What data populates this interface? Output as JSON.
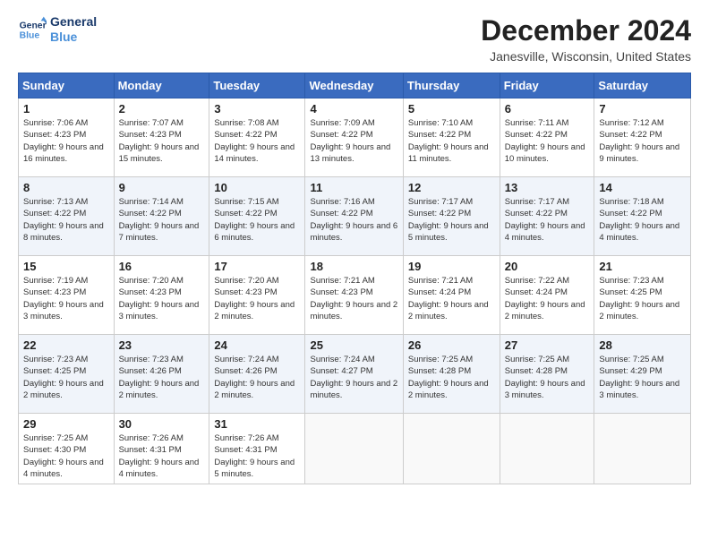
{
  "header": {
    "logo_line1": "General",
    "logo_line2": "Blue",
    "month_title": "December 2024",
    "location": "Janesville, Wisconsin, United States"
  },
  "weekdays": [
    "Sunday",
    "Monday",
    "Tuesday",
    "Wednesday",
    "Thursday",
    "Friday",
    "Saturday"
  ],
  "weeks": [
    [
      {
        "day": "1",
        "sunrise": "7:06 AM",
        "sunset": "4:23 PM",
        "daylight": "9 hours and 16 minutes."
      },
      {
        "day": "2",
        "sunrise": "7:07 AM",
        "sunset": "4:23 PM",
        "daylight": "9 hours and 15 minutes."
      },
      {
        "day": "3",
        "sunrise": "7:08 AM",
        "sunset": "4:22 PM",
        "daylight": "9 hours and 14 minutes."
      },
      {
        "day": "4",
        "sunrise": "7:09 AM",
        "sunset": "4:22 PM",
        "daylight": "9 hours and 13 minutes."
      },
      {
        "day": "5",
        "sunrise": "7:10 AM",
        "sunset": "4:22 PM",
        "daylight": "9 hours and 11 minutes."
      },
      {
        "day": "6",
        "sunrise": "7:11 AM",
        "sunset": "4:22 PM",
        "daylight": "9 hours and 10 minutes."
      },
      {
        "day": "7",
        "sunrise": "7:12 AM",
        "sunset": "4:22 PM",
        "daylight": "9 hours and 9 minutes."
      }
    ],
    [
      {
        "day": "8",
        "sunrise": "7:13 AM",
        "sunset": "4:22 PM",
        "daylight": "9 hours and 8 minutes."
      },
      {
        "day": "9",
        "sunrise": "7:14 AM",
        "sunset": "4:22 PM",
        "daylight": "9 hours and 7 minutes."
      },
      {
        "day": "10",
        "sunrise": "7:15 AM",
        "sunset": "4:22 PM",
        "daylight": "9 hours and 6 minutes."
      },
      {
        "day": "11",
        "sunrise": "7:16 AM",
        "sunset": "4:22 PM",
        "daylight": "9 hours and 6 minutes."
      },
      {
        "day": "12",
        "sunrise": "7:17 AM",
        "sunset": "4:22 PM",
        "daylight": "9 hours and 5 minutes."
      },
      {
        "day": "13",
        "sunrise": "7:17 AM",
        "sunset": "4:22 PM",
        "daylight": "9 hours and 4 minutes."
      },
      {
        "day": "14",
        "sunrise": "7:18 AM",
        "sunset": "4:22 PM",
        "daylight": "9 hours and 4 minutes."
      }
    ],
    [
      {
        "day": "15",
        "sunrise": "7:19 AM",
        "sunset": "4:23 PM",
        "daylight": "9 hours and 3 minutes."
      },
      {
        "day": "16",
        "sunrise": "7:20 AM",
        "sunset": "4:23 PM",
        "daylight": "9 hours and 3 minutes."
      },
      {
        "day": "17",
        "sunrise": "7:20 AM",
        "sunset": "4:23 PM",
        "daylight": "9 hours and 2 minutes."
      },
      {
        "day": "18",
        "sunrise": "7:21 AM",
        "sunset": "4:23 PM",
        "daylight": "9 hours and 2 minutes."
      },
      {
        "day": "19",
        "sunrise": "7:21 AM",
        "sunset": "4:24 PM",
        "daylight": "9 hours and 2 minutes."
      },
      {
        "day": "20",
        "sunrise": "7:22 AM",
        "sunset": "4:24 PM",
        "daylight": "9 hours and 2 minutes."
      },
      {
        "day": "21",
        "sunrise": "7:23 AM",
        "sunset": "4:25 PM",
        "daylight": "9 hours and 2 minutes."
      }
    ],
    [
      {
        "day": "22",
        "sunrise": "7:23 AM",
        "sunset": "4:25 PM",
        "daylight": "9 hours and 2 minutes."
      },
      {
        "day": "23",
        "sunrise": "7:23 AM",
        "sunset": "4:26 PM",
        "daylight": "9 hours and 2 minutes."
      },
      {
        "day": "24",
        "sunrise": "7:24 AM",
        "sunset": "4:26 PM",
        "daylight": "9 hours and 2 minutes."
      },
      {
        "day": "25",
        "sunrise": "7:24 AM",
        "sunset": "4:27 PM",
        "daylight": "9 hours and 2 minutes."
      },
      {
        "day": "26",
        "sunrise": "7:25 AM",
        "sunset": "4:28 PM",
        "daylight": "9 hours and 2 minutes."
      },
      {
        "day": "27",
        "sunrise": "7:25 AM",
        "sunset": "4:28 PM",
        "daylight": "9 hours and 3 minutes."
      },
      {
        "day": "28",
        "sunrise": "7:25 AM",
        "sunset": "4:29 PM",
        "daylight": "9 hours and 3 minutes."
      }
    ],
    [
      {
        "day": "29",
        "sunrise": "7:25 AM",
        "sunset": "4:30 PM",
        "daylight": "9 hours and 4 minutes."
      },
      {
        "day": "30",
        "sunrise": "7:26 AM",
        "sunset": "4:31 PM",
        "daylight": "9 hours and 4 minutes."
      },
      {
        "day": "31",
        "sunrise": "7:26 AM",
        "sunset": "4:31 PM",
        "daylight": "9 hours and 5 minutes."
      },
      null,
      null,
      null,
      null
    ]
  ],
  "labels": {
    "sunrise": "Sunrise:",
    "sunset": "Sunset:",
    "daylight": "Daylight:"
  }
}
